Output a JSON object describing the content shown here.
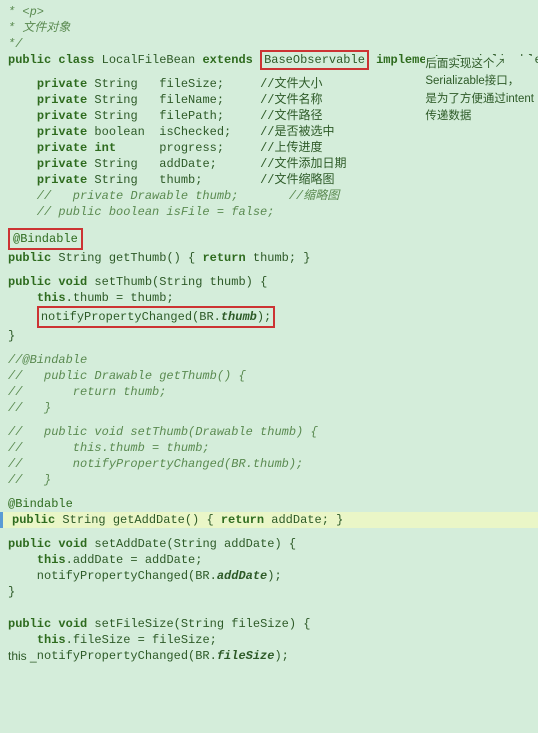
{
  "code": {
    "lines": [
      {
        "num": "",
        "content": "* <p>",
        "type": "comment"
      },
      {
        "num": "",
        "content": "* 文件对象",
        "type": "comment"
      },
      {
        "num": "",
        "content": "*/",
        "type": "comment"
      },
      {
        "num": "",
        "content": "PUBLIC_CLASS_LINE",
        "type": "special"
      },
      {
        "num": "",
        "content": "",
        "type": "empty"
      },
      {
        "num": "",
        "content": "    private String   fileSize;     //文件大小",
        "type": "field"
      },
      {
        "num": "",
        "content": "    private String   fileName;     //文件名称",
        "type": "field"
      },
      {
        "num": "",
        "content": "    private String   filePath;     //文件路径",
        "type": "field"
      },
      {
        "num": "",
        "content": "    private boolean  isChecked;    //是否被选中",
        "type": "field"
      },
      {
        "num": "",
        "content": "    private int      progress;     //上传进度",
        "type": "field"
      },
      {
        "num": "",
        "content": "    private String   addDate;      //文件添加日期",
        "type": "field"
      },
      {
        "num": "",
        "content": "    private String   thumb;        //文件缩略图",
        "type": "field"
      },
      {
        "num": "",
        "content": "    //   private Drawable thumb;       //缩略图",
        "type": "comment"
      },
      {
        "num": "",
        "content": "    // public boolean isFile = false;",
        "type": "comment"
      },
      {
        "num": "",
        "content": "",
        "type": "empty"
      },
      {
        "num": "",
        "content": "BINDABLE_ANNOTATION",
        "type": "special"
      },
      {
        "num": "",
        "content": "public String getThumb() { return thumb; }",
        "type": "method"
      },
      {
        "num": "",
        "content": "",
        "type": "empty"
      },
      {
        "num": "",
        "content": "public void setThumb(String thumb) {",
        "type": "method"
      },
      {
        "num": "",
        "content": "    this.thumb = thumb;",
        "type": "method"
      },
      {
        "num": "",
        "content": "NOTIFY_LINE",
        "type": "special"
      },
      {
        "num": "",
        "content": "}",
        "type": "brace"
      },
      {
        "num": "",
        "content": "",
        "type": "empty"
      },
      {
        "num": "",
        "content": "//@Bindable",
        "type": "comment"
      },
      {
        "num": "",
        "content": "//   public Drawable getThumb() {",
        "type": "comment"
      },
      {
        "num": "",
        "content": "//       return thumb;",
        "type": "comment"
      },
      {
        "num": "",
        "content": "//   }",
        "type": "comment"
      },
      {
        "num": "",
        "content": "",
        "type": "empty"
      },
      {
        "num": "",
        "content": "//   public void setThumb(Drawable thumb) {",
        "type": "comment"
      },
      {
        "num": "",
        "content": "//       this.thumb = thumb;",
        "type": "comment"
      },
      {
        "num": "",
        "content": "//       notifyPropertyChanged(BR.thumb);",
        "type": "comment"
      },
      {
        "num": "",
        "content": "//   }",
        "type": "comment"
      },
      {
        "num": "",
        "content": "",
        "type": "empty"
      },
      {
        "num": "",
        "content": "@Bindable",
        "type": "annotation"
      },
      {
        "num": "",
        "content": "public String getAddDate() { return addDate; }",
        "type": "method_yellow"
      },
      {
        "num": "",
        "content": "",
        "type": "empty"
      },
      {
        "num": "",
        "content": "public void setAddDate(String addDate) {",
        "type": "method"
      },
      {
        "num": "",
        "content": "    this.addDate = addDate;",
        "type": "method"
      },
      {
        "num": "",
        "content": "    notifyPropertyChanged(BR.addDate);",
        "type": "method"
      },
      {
        "num": "",
        "content": "}",
        "type": "brace"
      },
      {
        "num": "",
        "content": "",
        "type": "empty"
      },
      {
        "num": "",
        "content": "",
        "type": "empty"
      },
      {
        "num": "",
        "content": "public void setFileSize(String fileSize) {",
        "type": "method"
      },
      {
        "num": "",
        "content": "    this.fileSize = fileSize;",
        "type": "method"
      },
      {
        "num": "",
        "content": "    notifyPropertyChanged(BR.fileSize);",
        "type": "method_italic"
      }
    ],
    "callout": {
      "arrow": "↗",
      "text": "后面实现这个\nSerializable接口，\n是为了方便通过intent\n传递数据"
    },
    "bottom_text": "this _"
  }
}
